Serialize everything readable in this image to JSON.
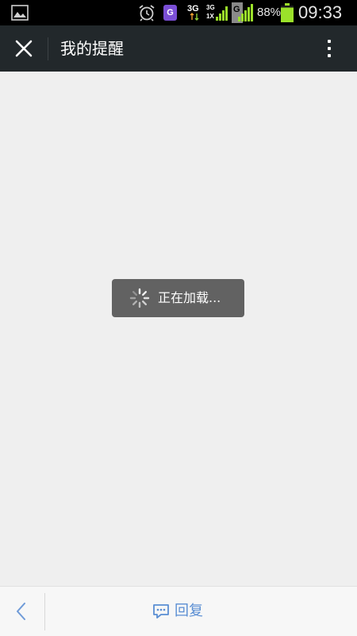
{
  "status_bar": {
    "battery_percent": "88%",
    "time": "09:33",
    "battery_level": 0.88,
    "icons": [
      "gallery-icon",
      "alarm-icon",
      "app-notification-icon",
      "network-3g-icon",
      "network-3g-1x-icon",
      "signal-g-icon",
      "battery-icon"
    ],
    "app_notif_glyph": "G",
    "net_3g_label": "3G",
    "net_3g_small_label": "3G",
    "net_1x_label": "1X",
    "signal_g_label": "G"
  },
  "title_bar": {
    "title": "我的提醒",
    "close_icon": "close-icon",
    "more_icon": "more-vertical-icon",
    "background": "#22282b"
  },
  "content": {
    "background": "#efefef"
  },
  "loading_toast": {
    "text": "正在加载...",
    "icon": "spinner-icon",
    "background": "#626262"
  },
  "bottom_bar": {
    "back_icon": "chevron-left-icon",
    "reply_label": "回复",
    "reply_icon": "comment-bubble-icon",
    "accent": "#5a8ed3"
  }
}
